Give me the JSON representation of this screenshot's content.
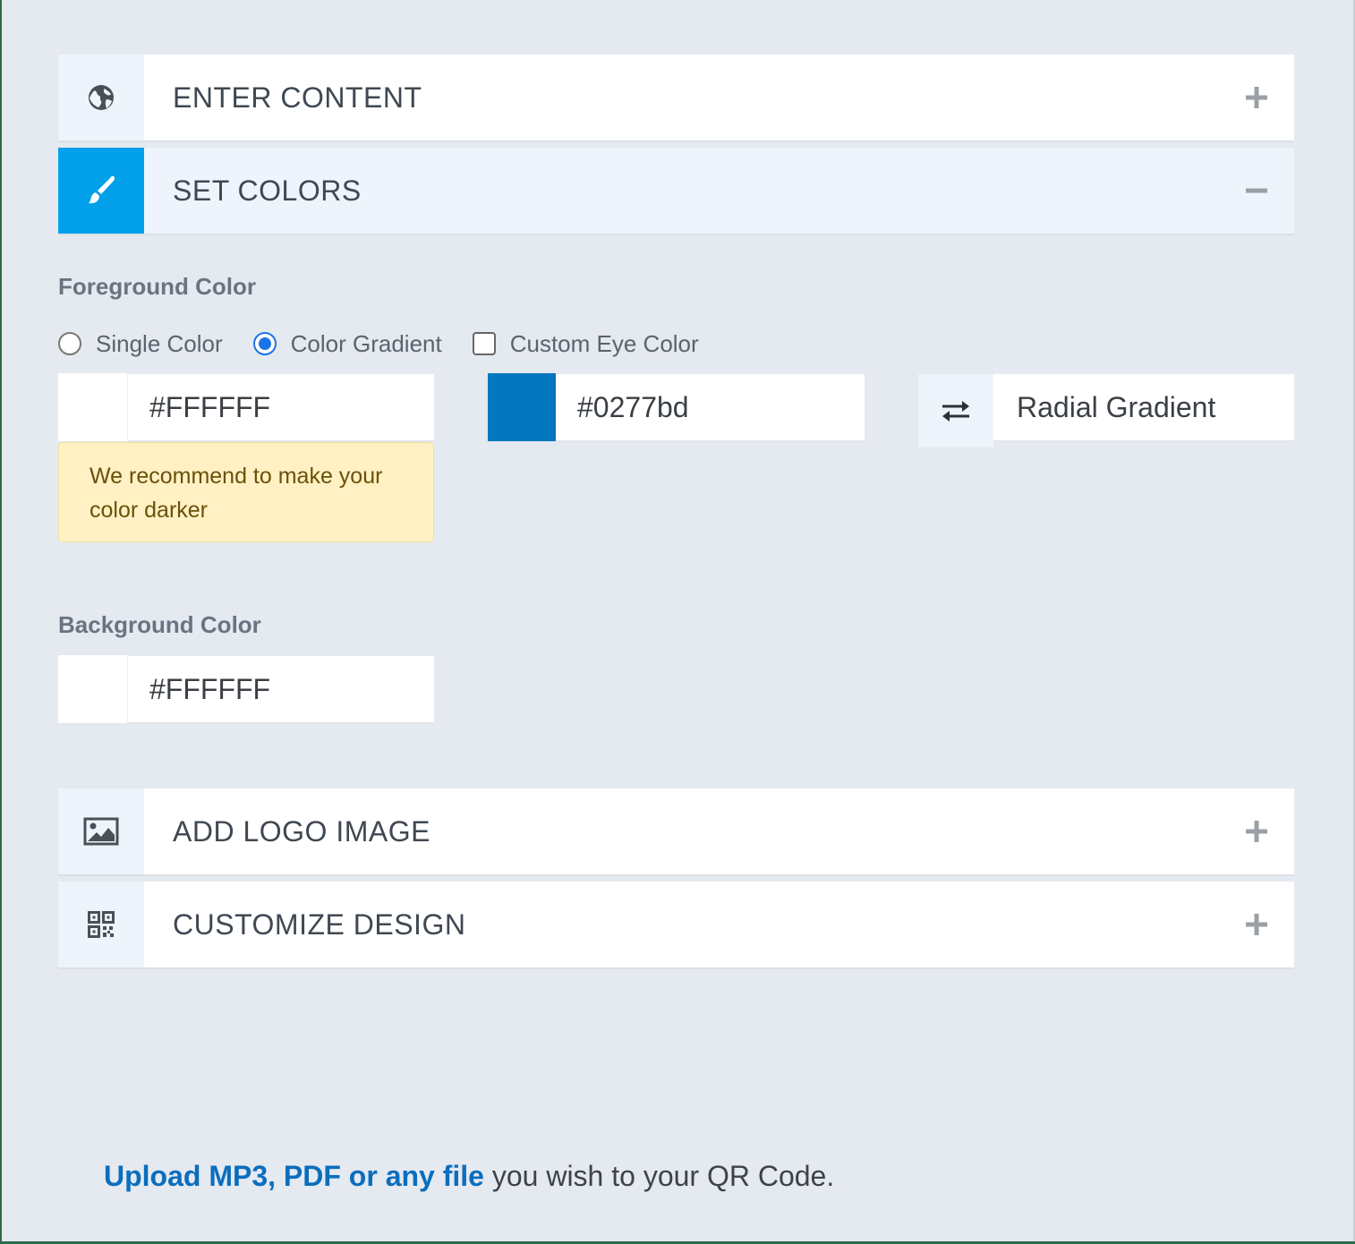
{
  "accordion": {
    "enter_content": {
      "title": "ENTER CONTENT",
      "icon": "globe-icon",
      "toggle": "+"
    },
    "set_colors": {
      "title": "SET COLORS",
      "icon": "paint-brush-icon",
      "toggle": "−",
      "active_color": "#02a0ea"
    },
    "add_logo": {
      "title": "ADD LOGO IMAGE",
      "icon": "image-icon",
      "toggle": "+"
    },
    "customize_design": {
      "title": "CUSTOMIZE DESIGN",
      "icon": "qr-code-icon",
      "toggle": "+"
    }
  },
  "foreground": {
    "label": "Foreground Color",
    "options": {
      "single": "Single Color",
      "gradient": "Color Gradient",
      "custom_eye": "Custom Eye Color"
    },
    "selected_option": "Color Gradient",
    "custom_eye_checked": false,
    "color1": "#FFFFFF",
    "color2": "#0277bd",
    "gradient_type": "Radial Gradient",
    "warning": "We recommend to make your color darker"
  },
  "background": {
    "label": "Background Color",
    "color": "#FFFFFF"
  },
  "upload": {
    "link_text": "Upload MP3, PDF or any file",
    "rest_text": " you wish to your QR Code."
  }
}
